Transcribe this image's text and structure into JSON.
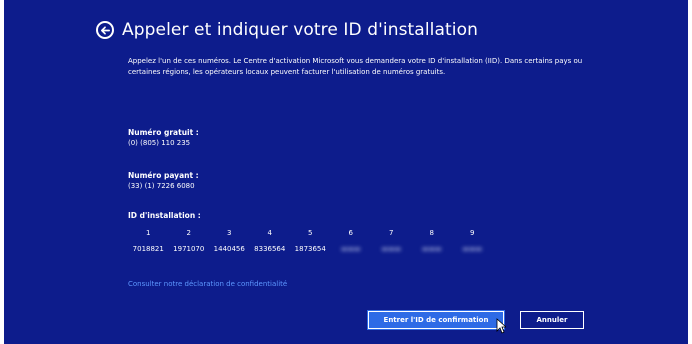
{
  "dialog": {
    "title": "Appeler et indiquer votre ID d'installation",
    "intro": "Appelez l'un de ces numéros. Le Centre d'activation Microsoft vous demandera votre ID d'installation (IID). Dans certains pays ou certaines régions, les opérateurs locaux peuvent facturer l'utilisation de numéros gratuits."
  },
  "free_number": {
    "label": "Numéro gratuit :",
    "value": "(0) (805) 110 235"
  },
  "paid_number": {
    "label": "Numéro payant :",
    "value": "(33) (1) 7226 6080"
  },
  "installation_id": {
    "label": "ID d'installation :",
    "group_numbers": [
      "1",
      "2",
      "3",
      "4",
      "5",
      "6",
      "7",
      "8",
      "9"
    ],
    "groups_visible": [
      "7018821",
      "1971070",
      "1440456",
      "8336564",
      "1873654"
    ]
  },
  "privacy_link": "Consulter notre déclaration de confidentialité",
  "buttons": {
    "confirm": "Entrer l'ID de confirmation",
    "cancel": "Annuler"
  },
  "colors": {
    "background": "#0d1c8c",
    "accent_button": "#2e6be6",
    "link": "#5d97ff"
  }
}
